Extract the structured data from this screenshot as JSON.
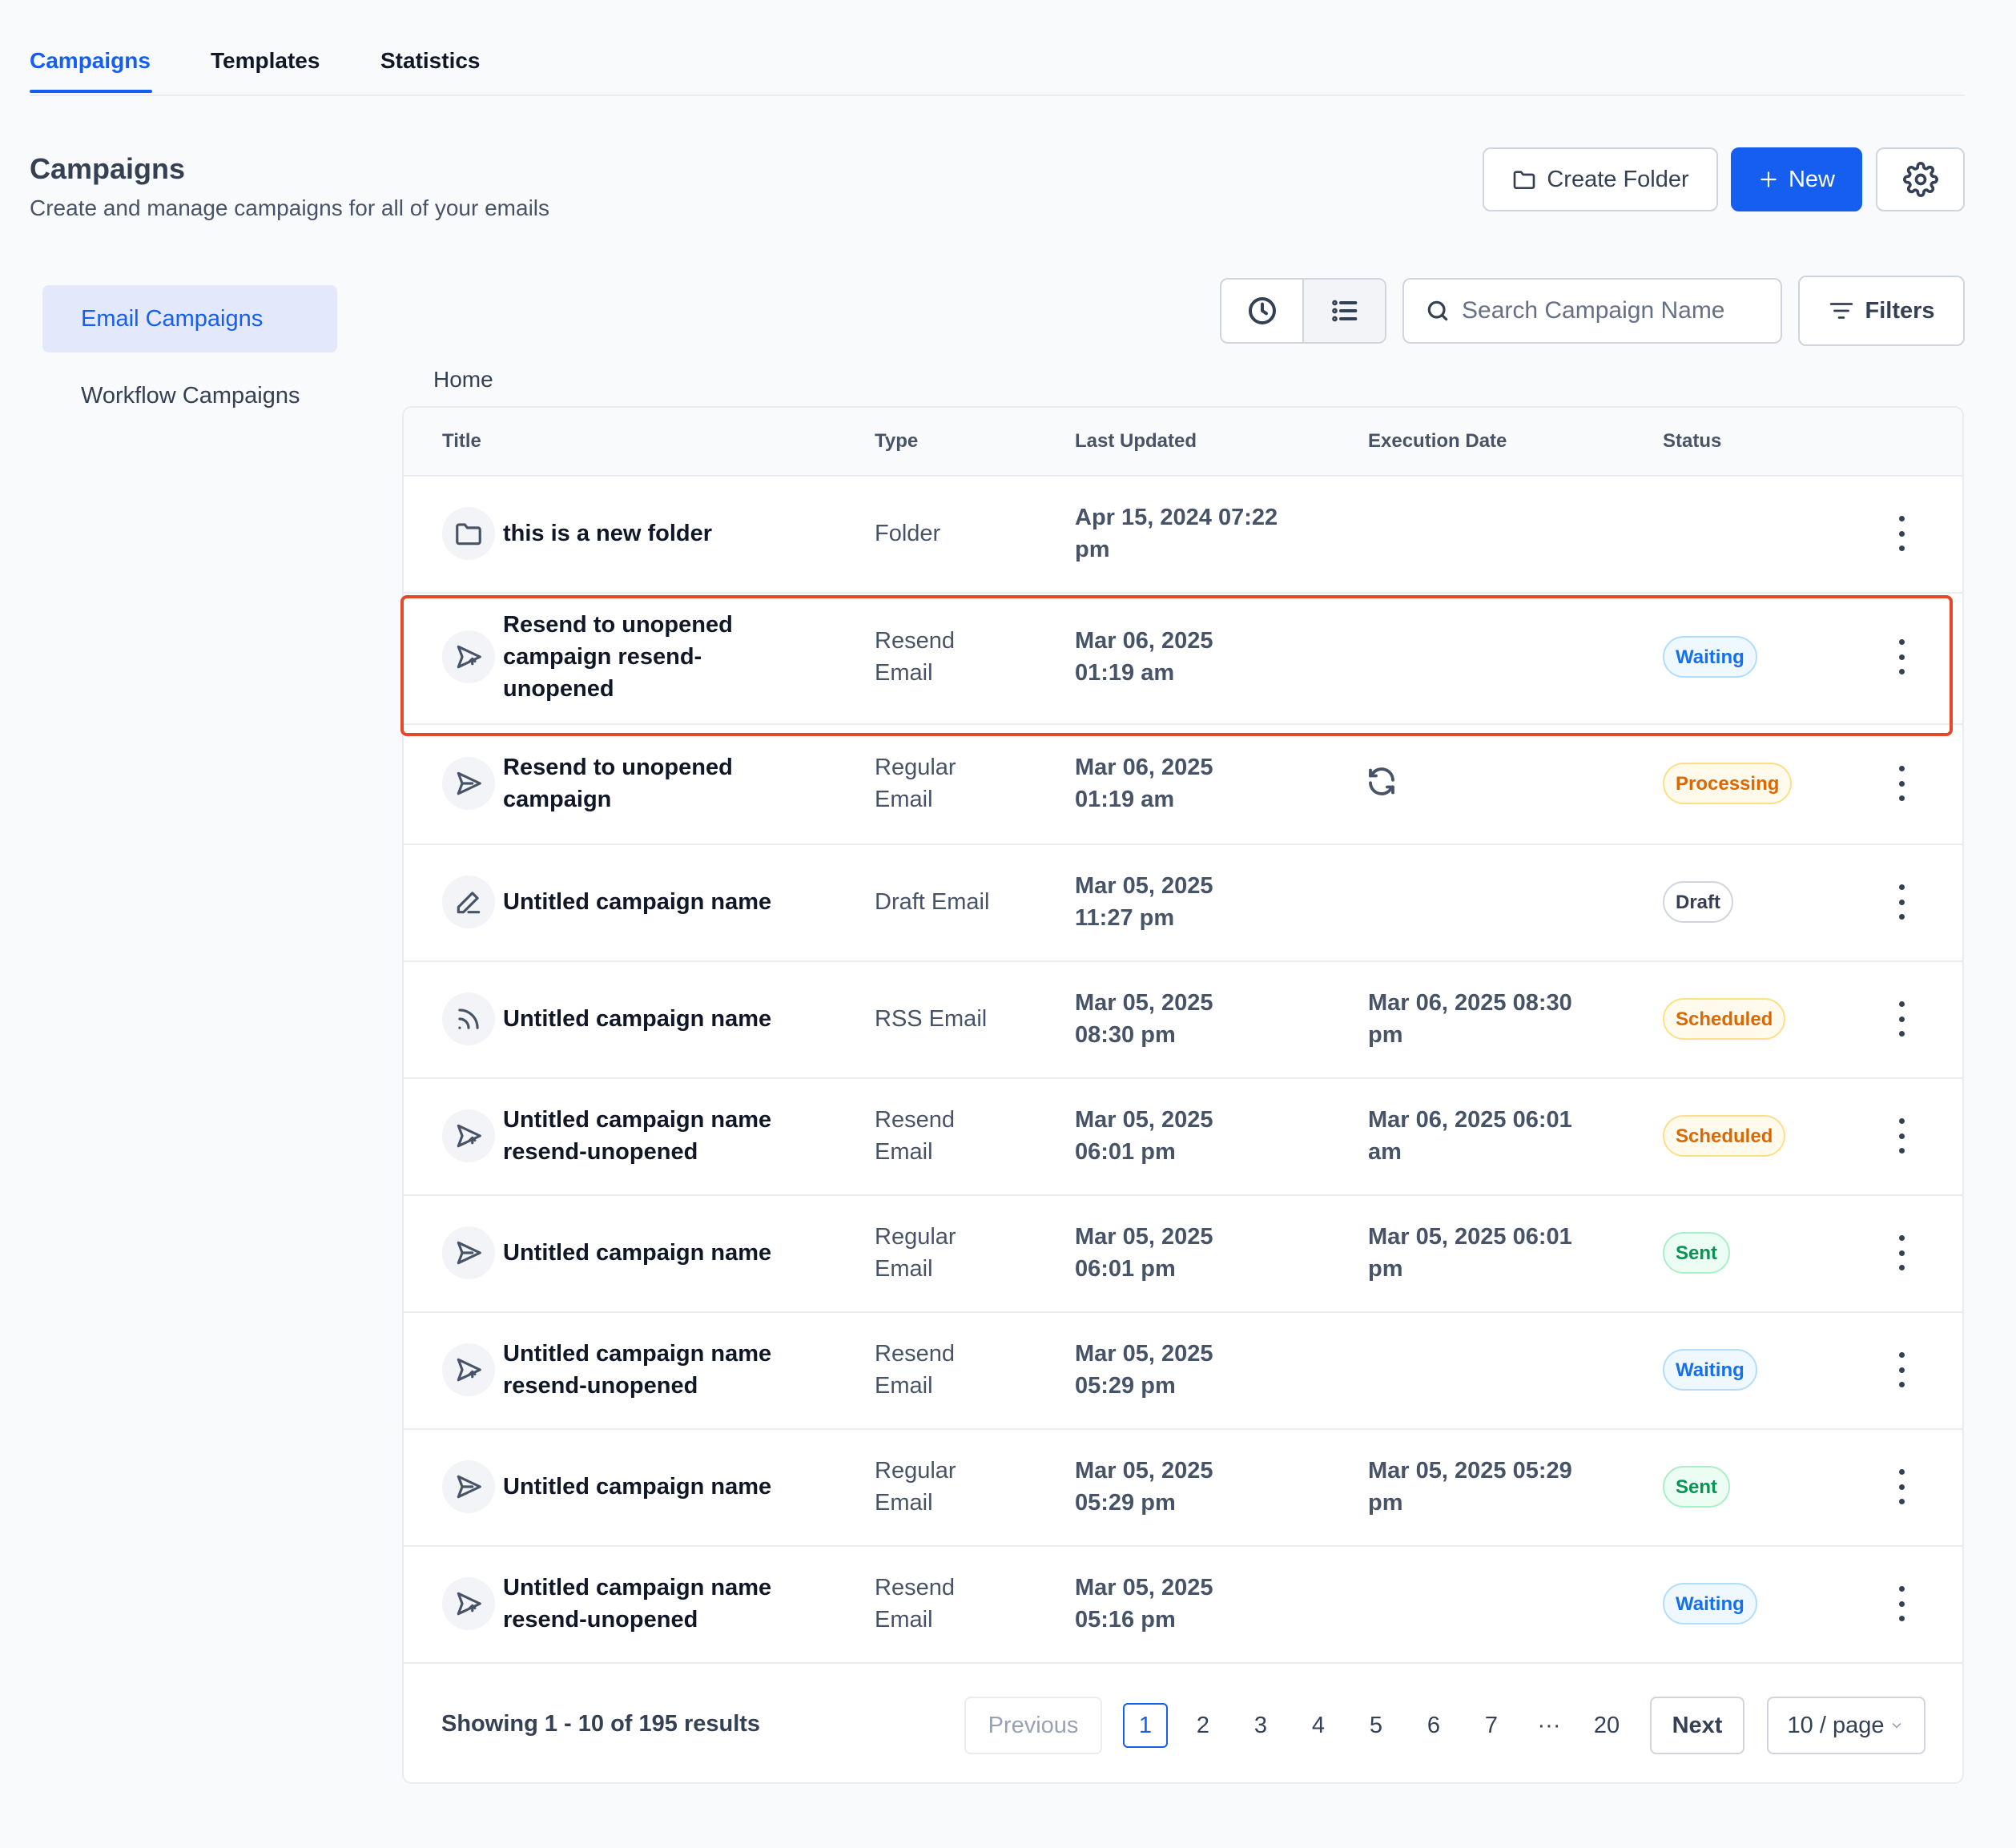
{
  "tabs": [
    {
      "label": "Campaigns",
      "active": true
    },
    {
      "label": "Templates",
      "active": false
    },
    {
      "label": "Statistics",
      "active": false
    }
  ],
  "header": {
    "title": "Campaigns",
    "subtitle": "Create and manage campaigns for all of your emails",
    "create_folder_label": "Create Folder",
    "new_label": "New"
  },
  "sidebar": {
    "items": [
      {
        "label": "Email Campaigns",
        "active": true
      },
      {
        "label": "Workflow Campaigns",
        "active": false
      }
    ]
  },
  "toolbar": {
    "search_placeholder": "Search Campaign Name",
    "filters_label": "Filters"
  },
  "breadcrumb": "Home",
  "table": {
    "columns": [
      "Title",
      "Type",
      "Last Updated",
      "Execution Date",
      "Status"
    ],
    "rows": [
      {
        "icon": "folder-icon",
        "title_l1": "this is a new folder",
        "title_l2": "",
        "title_l3": "",
        "type_l1": "Folder",
        "type_l2": "",
        "updated_l1": "Apr 15, 2024 07:22",
        "updated_l2": "pm",
        "exec_l1": "",
        "exec_l2": "",
        "status": ""
      },
      {
        "icon": "resend-icon",
        "title_l1": "Resend to unopened",
        "title_l2": "campaign resend-",
        "title_l3": "unopened",
        "type_l1": "Resend",
        "type_l2": "Email",
        "updated_l1": "Mar 06, 2025",
        "updated_l2": "01:19 am",
        "exec_l1": "",
        "exec_l2": "",
        "status": "Waiting"
      },
      {
        "icon": "send-icon",
        "title_l1": "Resend to unopened",
        "title_l2": "campaign",
        "title_l3": "",
        "type_l1": "Regular",
        "type_l2": "Email",
        "updated_l1": "Mar 06, 2025",
        "updated_l2": "01:19 am",
        "exec_l1": "",
        "exec_l2": "",
        "exec_icon": "refresh-icon",
        "status": "Processing"
      },
      {
        "icon": "edit-icon",
        "title_l1": "Untitled campaign name",
        "title_l2": "",
        "title_l3": "",
        "type_l1": "Draft Email",
        "type_l2": "",
        "updated_l1": "Mar 05, 2025",
        "updated_l2": "11:27 pm",
        "exec_l1": "",
        "exec_l2": "",
        "status": "Draft"
      },
      {
        "icon": "rss-icon",
        "title_l1": "Untitled campaign name",
        "title_l2": "",
        "title_l3": "",
        "type_l1": "RSS Email",
        "type_l2": "",
        "updated_l1": "Mar 05, 2025",
        "updated_l2": "08:30 pm",
        "exec_l1": "Mar 06, 2025 08:30",
        "exec_l2": "pm",
        "status": "Scheduled"
      },
      {
        "icon": "resend-icon",
        "title_l1": "Untitled campaign name",
        "title_l2": "resend-unopened",
        "title_l3": "",
        "type_l1": "Resend",
        "type_l2": "Email",
        "updated_l1": "Mar 05, 2025",
        "updated_l2": "06:01 pm",
        "exec_l1": "Mar 06, 2025 06:01",
        "exec_l2": "am",
        "status": "Scheduled"
      },
      {
        "icon": "send-icon",
        "title_l1": "Untitled campaign name",
        "title_l2": "",
        "title_l3": "",
        "type_l1": "Regular",
        "type_l2": "Email",
        "updated_l1": "Mar 05, 2025",
        "updated_l2": "06:01 pm",
        "exec_l1": "Mar 05, 2025 06:01",
        "exec_l2": "pm",
        "status": "Sent"
      },
      {
        "icon": "resend-icon",
        "title_l1": "Untitled campaign name",
        "title_l2": "resend-unopened",
        "title_l3": "",
        "type_l1": "Resend",
        "type_l2": "Email",
        "updated_l1": "Mar 05, 2025",
        "updated_l2": "05:29 pm",
        "exec_l1": "",
        "exec_l2": "",
        "status": "Waiting"
      },
      {
        "icon": "send-icon",
        "title_l1": "Untitled campaign name",
        "title_l2": "",
        "title_l3": "",
        "type_l1": "Regular",
        "type_l2": "Email",
        "updated_l1": "Mar 05, 2025",
        "updated_l2": "05:29 pm",
        "exec_l1": "Mar 05, 2025 05:29",
        "exec_l2": "pm",
        "status": "Sent"
      },
      {
        "icon": "resend-icon",
        "title_l1": "Untitled campaign name",
        "title_l2": "resend-unopened",
        "title_l3": "",
        "type_l1": "Resend",
        "type_l2": "Email",
        "updated_l1": "Mar 05, 2025",
        "updated_l2": "05:16 pm",
        "exec_l1": "",
        "exec_l2": "",
        "status": "Waiting"
      }
    ]
  },
  "pagination": {
    "showing": "Showing 1 - 10 of 195 results",
    "previous": "Previous",
    "next": "Next",
    "pages": [
      "1",
      "2",
      "3",
      "4",
      "5",
      "6",
      "7",
      "···",
      "20"
    ],
    "current": "1",
    "per_page": "10 / page"
  },
  "colors": {
    "accent": "#155eef",
    "highlight": "#e8462a"
  }
}
